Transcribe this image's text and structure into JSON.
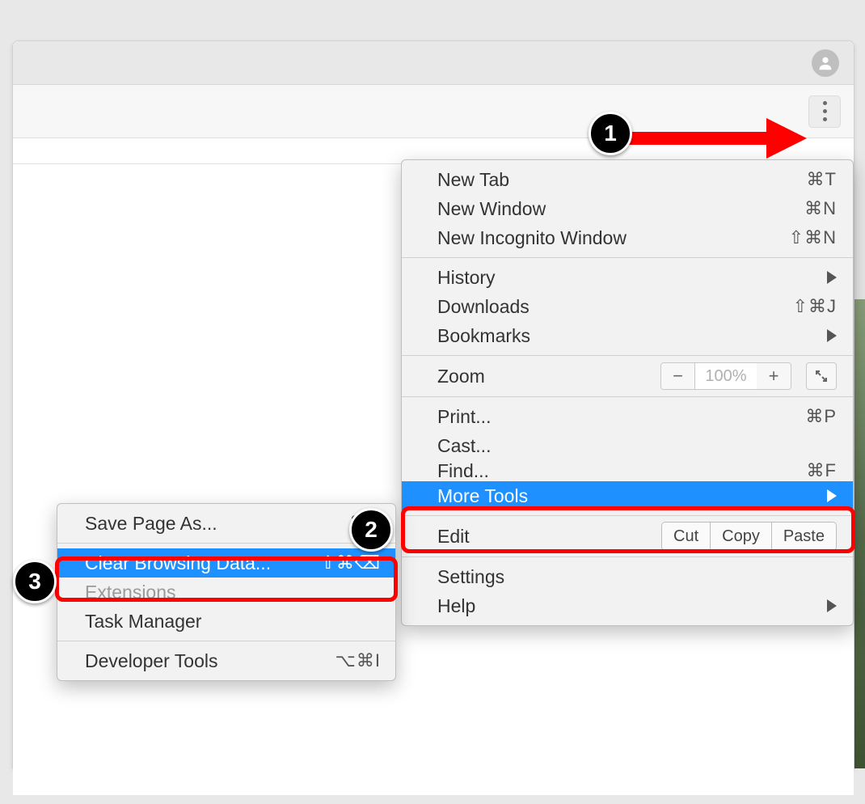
{
  "annotations": {
    "step1": "1",
    "step2": "2",
    "step3": "3"
  },
  "menu": {
    "new_tab": {
      "label": "New Tab",
      "shortcut": "⌘T"
    },
    "new_window": {
      "label": "New Window",
      "shortcut": "⌘N"
    },
    "new_incognito": {
      "label": "New Incognito Window",
      "shortcut": "⇧⌘N"
    },
    "history": {
      "label": "History"
    },
    "downloads": {
      "label": "Downloads",
      "shortcut": "⇧⌘J"
    },
    "bookmarks": {
      "label": "Bookmarks"
    },
    "zoom": {
      "label": "Zoom",
      "value": "100%"
    },
    "print": {
      "label": "Print...",
      "shortcut": "⌘P"
    },
    "cast": {
      "label": "Cast..."
    },
    "find": {
      "label": "Find...",
      "shortcut": "⌘F"
    },
    "more_tools": {
      "label": "More Tools"
    },
    "edit": {
      "label": "Edit",
      "cut": "Cut",
      "copy": "Copy",
      "paste": "Paste"
    },
    "settings": {
      "label": "Settings"
    },
    "help": {
      "label": "Help"
    }
  },
  "submenu": {
    "save_page": {
      "label": "Save Page As...",
      "shortcut": "⌘S"
    },
    "clear_data": {
      "label": "Clear Browsing Data...",
      "shortcut": "⇧⌘⌫"
    },
    "extensions": {
      "label": "Extensions"
    },
    "task_manager": {
      "label": "Task Manager"
    },
    "developer_tools": {
      "label": "Developer Tools",
      "shortcut": "⌥⌘I"
    }
  }
}
